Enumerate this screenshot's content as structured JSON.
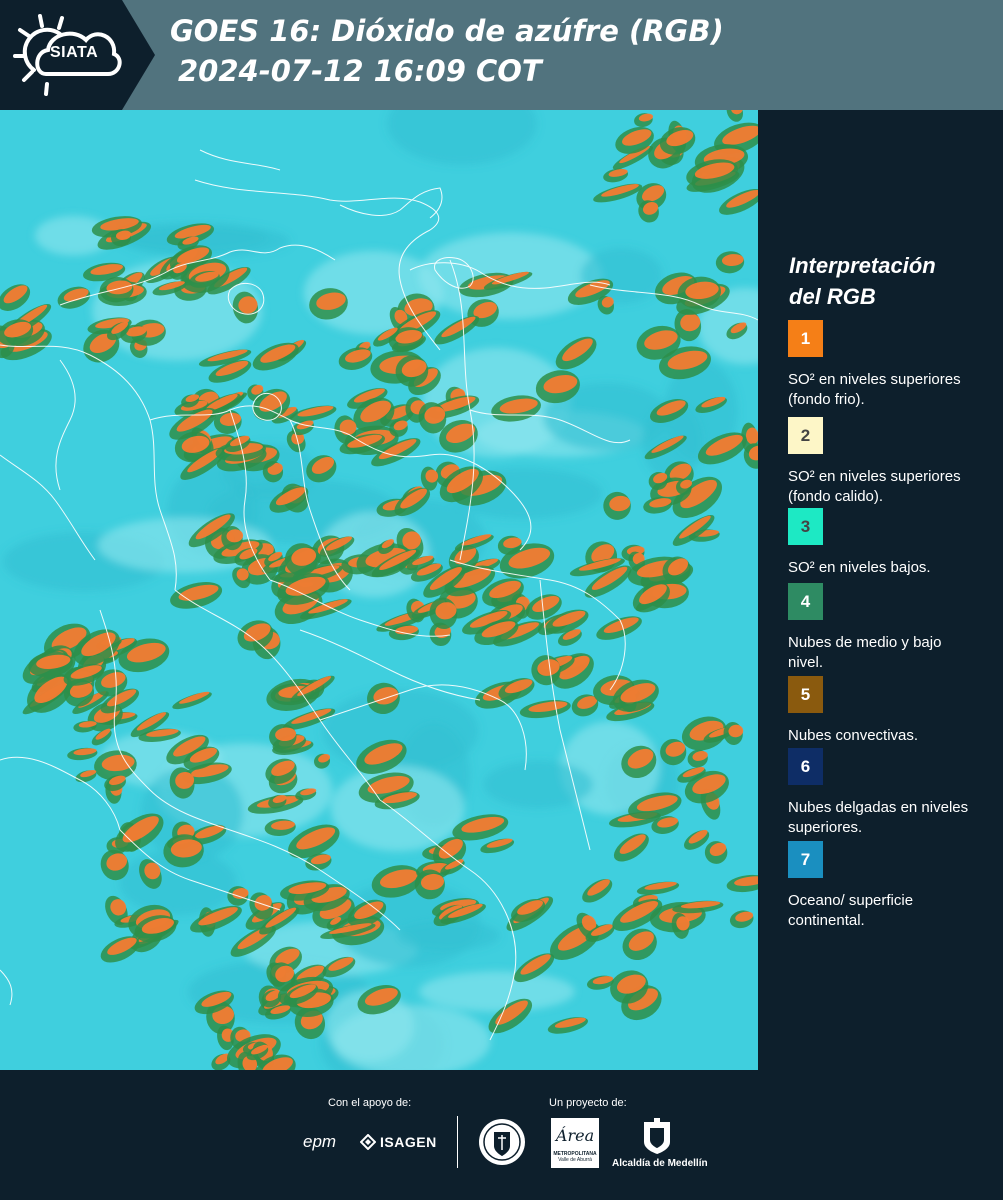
{
  "header": {
    "logo_text": "SIATA",
    "title_line1": "GOES 16: Dióxido de azúfre (RGB)",
    "title_line2": "2024-07-12 16:09 COT"
  },
  "legend": {
    "title_line1": "Interpretación",
    "title_line2": "del RGB",
    "items": [
      {
        "number": "1",
        "text": "SO² en niveles superiores (fondo frio).",
        "color": "#f57f17"
      },
      {
        "number": "2",
        "text": "SO² en niveles superiores (fondo calido).",
        "color": "#fdf6c7"
      },
      {
        "number": "3",
        "text": "SO² en niveles bajos.",
        "color": "#1de9c4"
      },
      {
        "number": "4",
        "text": "Nubes de medio y bajo nivel.",
        "color": "#2e8b63"
      },
      {
        "number": "5",
        "text": "Nubes convectivas.",
        "color": "#8a5a0e"
      },
      {
        "number": "6",
        "text": "Nubes delgadas en niveles superiores.",
        "color": "#0e2d66"
      },
      {
        "number": "7",
        "text": "Oceano/ superficie continental.",
        "color": "#1a8fc0"
      }
    ]
  },
  "map": {
    "colors": {
      "background": "#3fcfde",
      "clouds_low": "#2e8f4a",
      "clouds_high": "#ff7a30"
    }
  },
  "footer": {
    "support_label": "Con el apoyo de:",
    "project_label": "Un proyecto de:",
    "sponsors": [
      "epm",
      "ISAGEN"
    ],
    "partners": [
      "Área Metropolitana Valle de Aburrá",
      "Alcaldía de Medellín"
    ],
    "area_logo_text": "Área",
    "area_caption": "METROPOLITANA",
    "area_caption2": "Valle de Aburrá",
    "alcaldia_caption": "Alcaldía de Medellín"
  }
}
